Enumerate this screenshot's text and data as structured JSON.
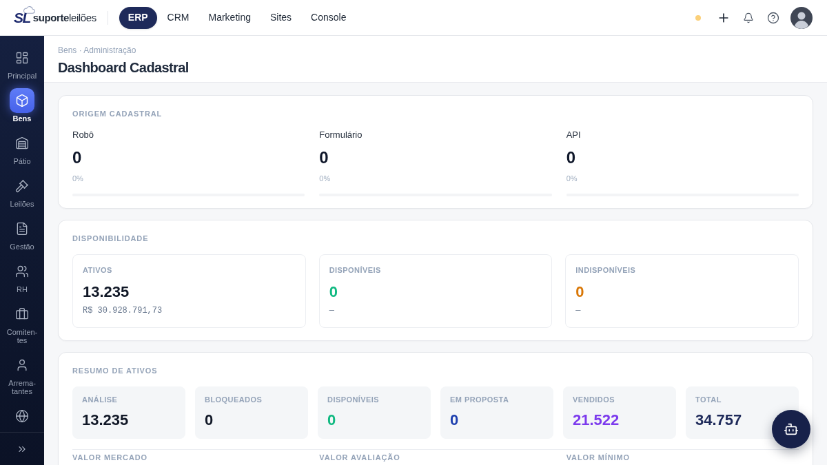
{
  "topbar": {
    "logo": {
      "mark": "SL",
      "wordmark": "**suporte**leilões"
    },
    "nav": [
      {
        "label": "ERP",
        "selected": true
      },
      {
        "label": "CRM",
        "selected": false
      },
      {
        "label": "Marketing",
        "selected": false
      },
      {
        "label": "Sites",
        "selected": false
      },
      {
        "label": "Console",
        "selected": false
      }
    ]
  },
  "sidebar": {
    "items": [
      {
        "label": "Principal",
        "selected": false
      },
      {
        "label": "Bens",
        "selected": true
      },
      {
        "label": "Pátio",
        "selected": false
      },
      {
        "label": "Leilões",
        "selected": false
      },
      {
        "label": "Gestão",
        "selected": false
      },
      {
        "label": "RH",
        "selected": false
      },
      {
        "label": "Comiten-tes",
        "selected": false
      },
      {
        "label": "Arrema-tantes",
        "selected": false
      }
    ]
  },
  "header": {
    "breadcrumb": "Bens · Administração",
    "title": "Dashboard Cadastral"
  },
  "origem": {
    "title": "ORIGEM CADASTRAL",
    "items": [
      {
        "label": "Robô",
        "value": "0",
        "percent": "0%",
        "level": 0
      },
      {
        "label": "Formulário",
        "value": "0",
        "percent": "0%",
        "level": 0
      },
      {
        "label": "API",
        "value": "0",
        "percent": "0%",
        "level": 0
      }
    ]
  },
  "disponibilidade": {
    "title": "DISPONIBILIDADE",
    "items": [
      {
        "label": "ATIVOS",
        "value": "13.235",
        "detail": "R$ 30.928.791,73",
        "color": "#111827"
      },
      {
        "label": "DISPONÍVEIS",
        "value": "0",
        "detail": "—",
        "color": "#10b981"
      },
      {
        "label": "INDISPONÍVEIS",
        "value": "0",
        "detail": "—",
        "color": "#d97706"
      }
    ]
  },
  "resumo": {
    "title": "RESUMO DE ATIVOS",
    "tiles": [
      {
        "label": "ANÁLISE",
        "value": "13.235",
        "color": "#111827"
      },
      {
        "label": "BLOQUEADOS",
        "value": "0",
        "color": "#111827"
      },
      {
        "label": "DISPONÍVEIS",
        "value": "0",
        "color": "#10b981"
      },
      {
        "label": "EM PROPOSTA",
        "value": "0",
        "color": "#1e40af"
      },
      {
        "label": "VENDIDOS",
        "value": "21.522",
        "color": "#7c3aed"
      },
      {
        "label": "TOTAL",
        "value": "34.757",
        "color": "#1e2a5a"
      }
    ],
    "value_columns": [
      {
        "label": "VALOR MERCADO"
      },
      {
        "label": "VALOR AVALIAÇÃO"
      },
      {
        "label": "VALOR MÍNIMO"
      }
    ]
  }
}
